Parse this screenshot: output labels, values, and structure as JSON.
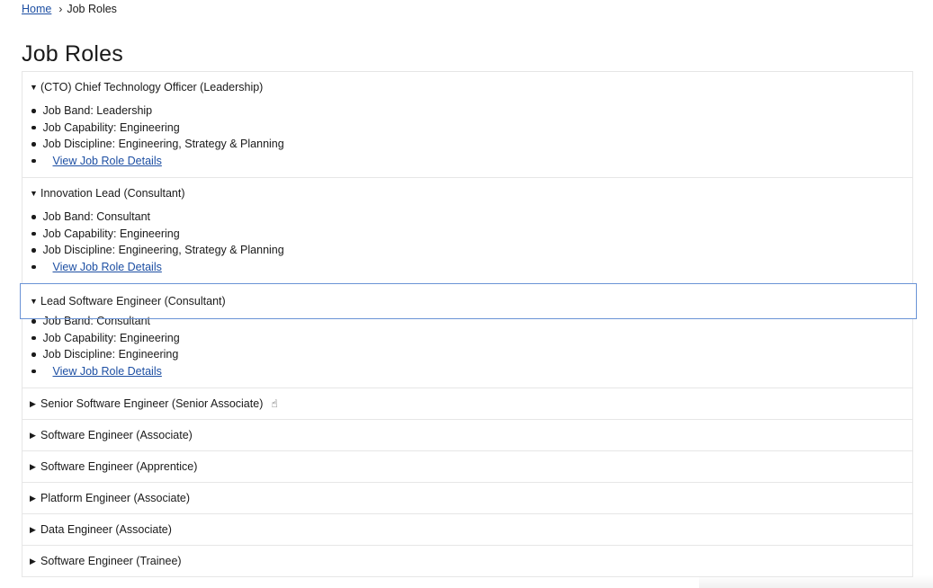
{
  "breadcrumb": {
    "home": "Home",
    "separator": "›",
    "current": "Job Roles"
  },
  "page_title": "Job Roles",
  "roles": [
    {
      "expanded": true,
      "marker": "▼",
      "title": "(CTO) Chief Technology Officer (Leadership)",
      "band": "Job Band: Leadership",
      "capability": "Job Capability: Engineering",
      "discipline": "Job Discipline: Engineering, Strategy & Planning",
      "link": "View Job Role Details"
    },
    {
      "expanded": true,
      "marker": "▼",
      "title": "Innovation Lead (Consultant)",
      "band": "Job Band: Consultant",
      "capability": "Job Capability: Engineering",
      "discipline": "Job Discipline: Engineering, Strategy & Planning",
      "link": "View Job Role Details"
    },
    {
      "expanded": true,
      "focused": true,
      "marker": "▼",
      "title": "Lead Software Engineer (Consultant)",
      "band": "Job Band: Consultant",
      "capability": "Job Capability: Engineering",
      "discipline": "Job Discipline: Engineering",
      "link": "View Job Role Details"
    },
    {
      "expanded": false,
      "marker": "▶",
      "title": "Senior Software Engineer (Senior Associate)",
      "cursor_icon": "hand-pointer-icon"
    },
    {
      "expanded": false,
      "marker": "▶",
      "title": "Software Engineer (Associate)"
    },
    {
      "expanded": false,
      "marker": "▶",
      "title": "Software Engineer (Apprentice)"
    },
    {
      "expanded": false,
      "marker": "▶",
      "title": "Platform Engineer (Associate)"
    },
    {
      "expanded": false,
      "marker": "▶",
      "title": "Data Engineer (Associate)"
    },
    {
      "expanded": false,
      "marker": "▶",
      "title": "Software Engineer (Trainee)"
    }
  ],
  "colors": {
    "link": "#1d4fa3",
    "focus_outline": "#6a93d6",
    "border": "#e6e6e6"
  }
}
